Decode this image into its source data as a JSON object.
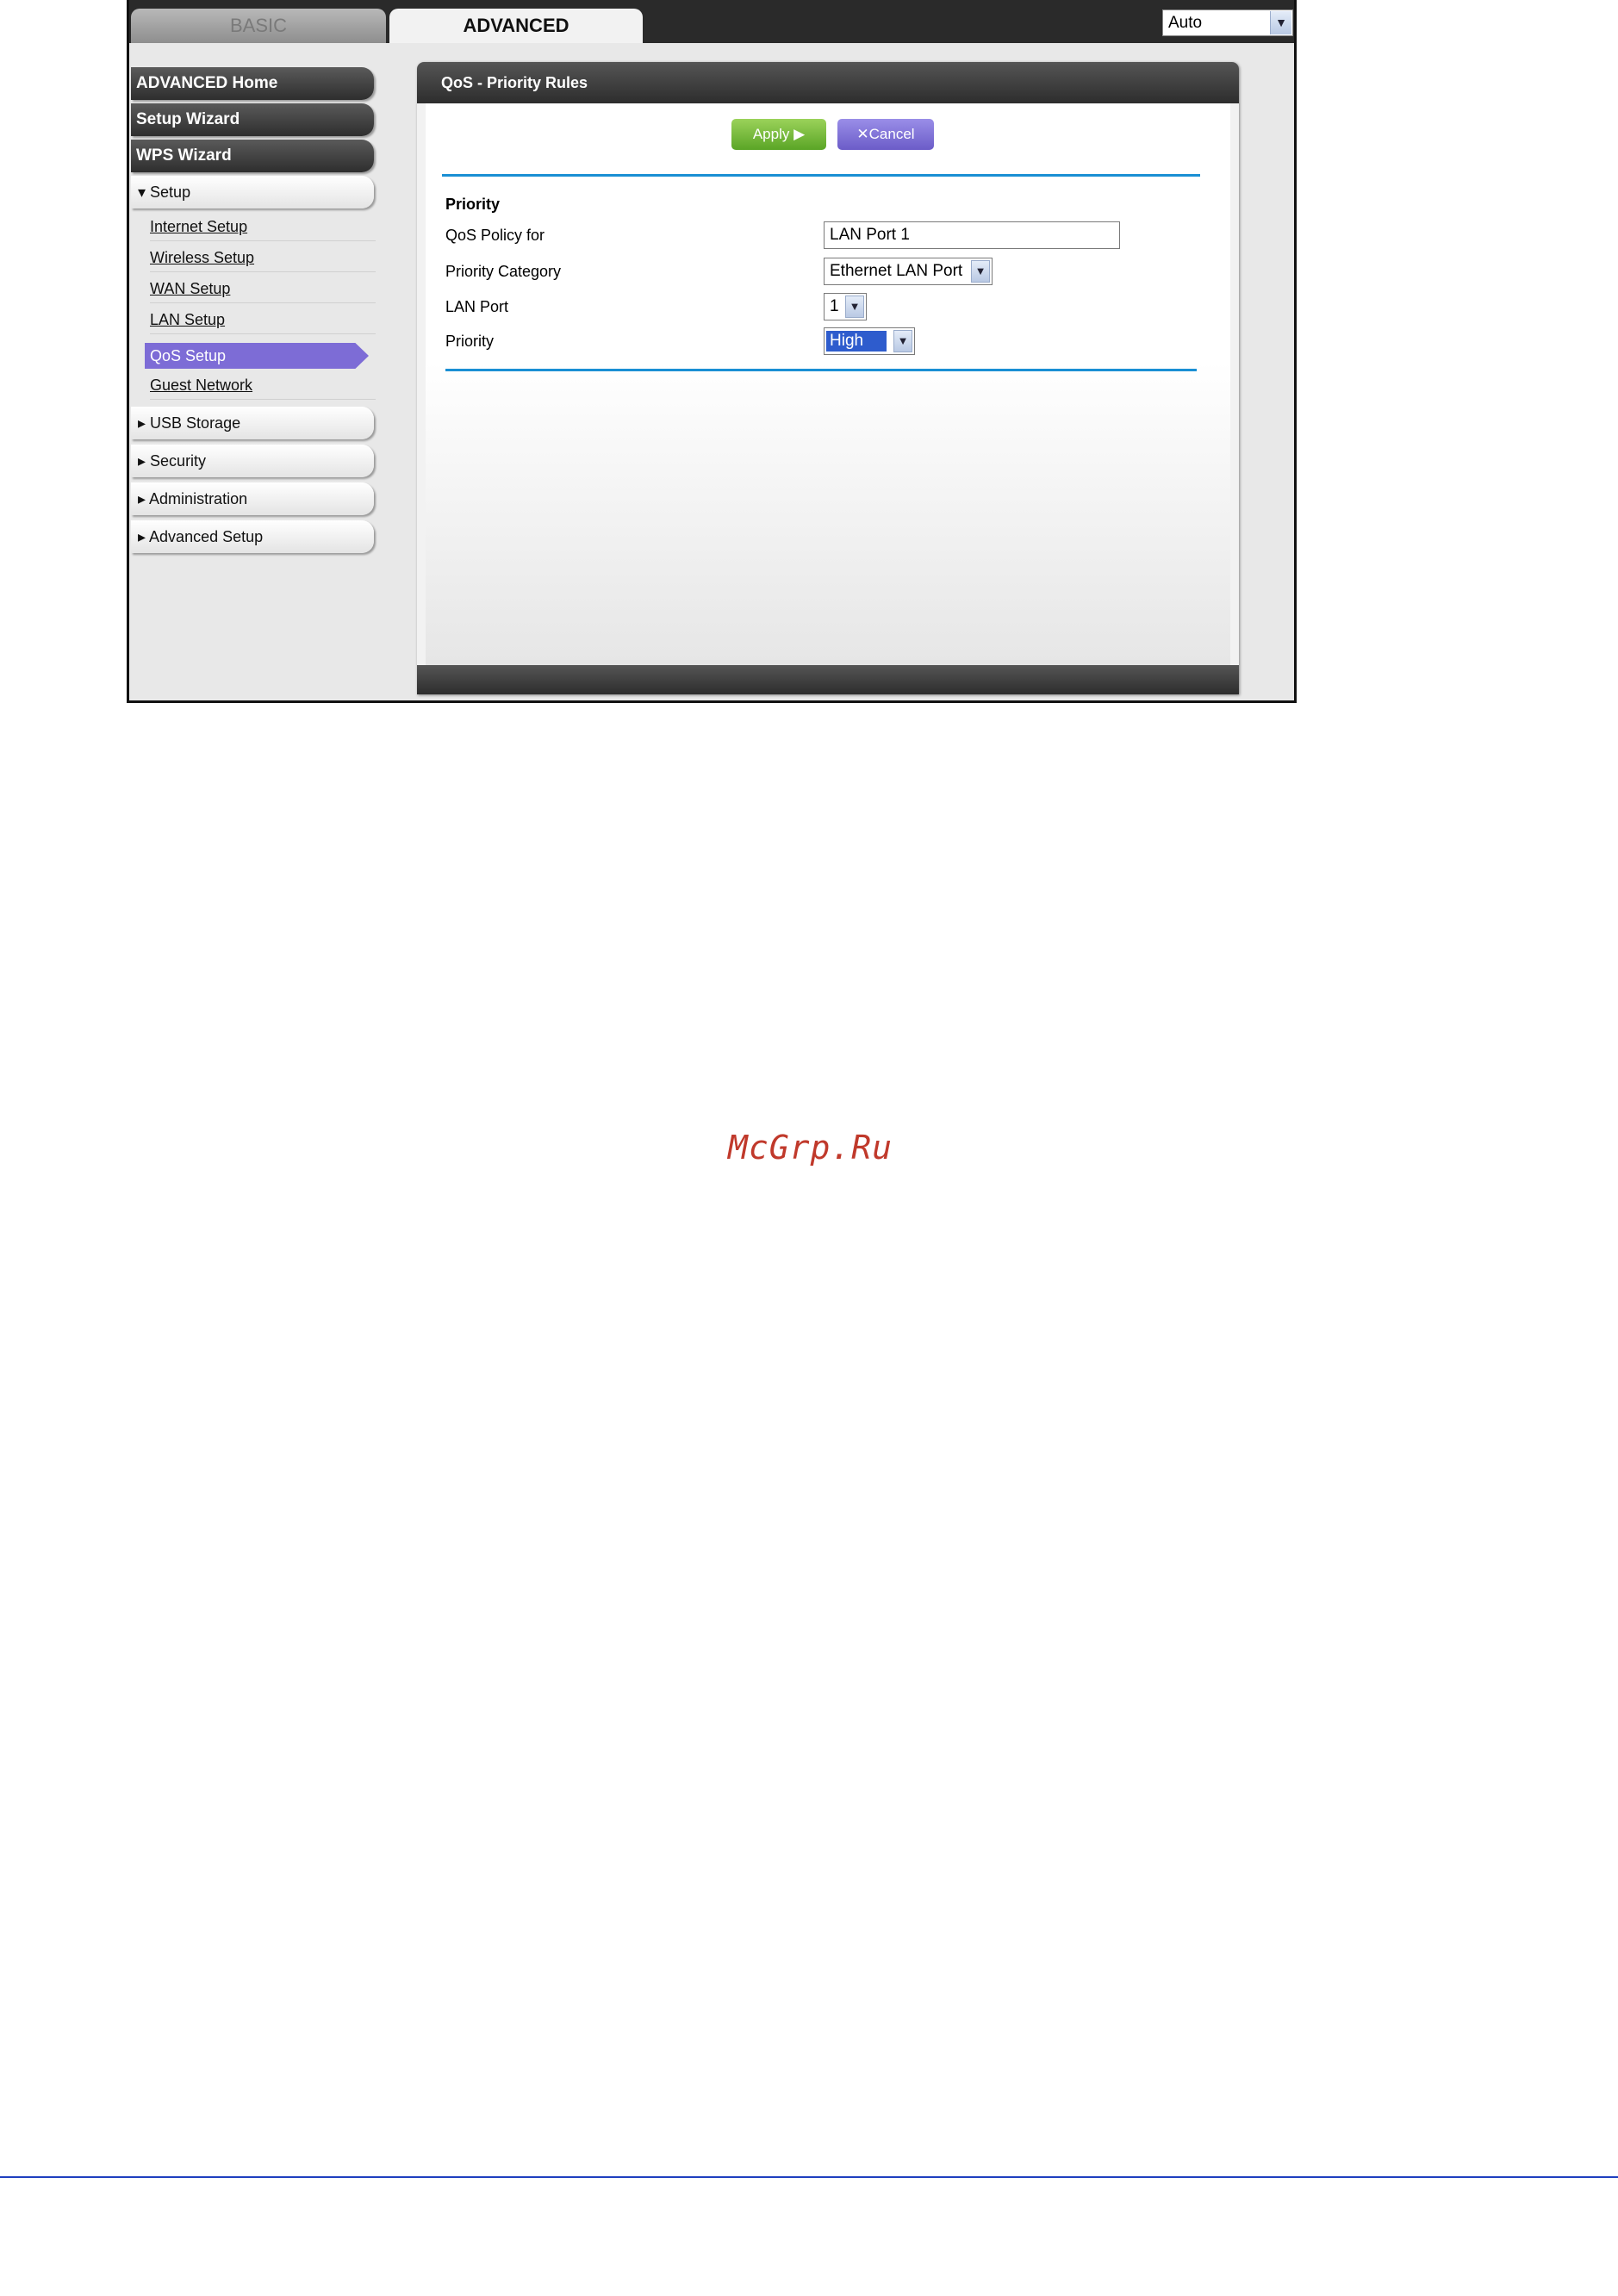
{
  "tabs": {
    "basic": "BASIC",
    "advanced": "ADVANCED"
  },
  "language_select": {
    "value": "Auto"
  },
  "sidebar": {
    "advanced_home": "ADVANCED Home",
    "setup_wizard": "Setup Wizard",
    "wps_wizard": "WPS Wizard",
    "setup": "▾ Setup",
    "setup_items": [
      "Internet Setup",
      "Wireless Setup",
      "WAN Setup",
      "LAN Setup",
      "QoS Setup",
      "Guest Network"
    ],
    "usb_storage": "▸ USB Storage",
    "security": "▸ Security",
    "administration": "▸ Administration",
    "advanced_setup": "▸ Advanced Setup"
  },
  "panel": {
    "title": "QoS - Priority Rules",
    "apply_label": "Apply ▶",
    "cancel_label": "✕Cancel",
    "section_title": "Priority",
    "qos_policy_label": "QoS Policy for",
    "qos_policy_value": "LAN Port 1",
    "priority_category_label": "Priority Category",
    "priority_category_value": "Ethernet LAN Port",
    "lan_port_label": "LAN Port",
    "lan_port_value": "1",
    "priority_label": "Priority",
    "priority_value": "High"
  },
  "watermark": "McGrp.Ru",
  "colors": {
    "accent_rule": "#1a8fd4",
    "active_nav": "#7d6cd6",
    "apply": "#5aa526",
    "cancel": "#6b5cc8",
    "watermark": "#c0392b"
  }
}
